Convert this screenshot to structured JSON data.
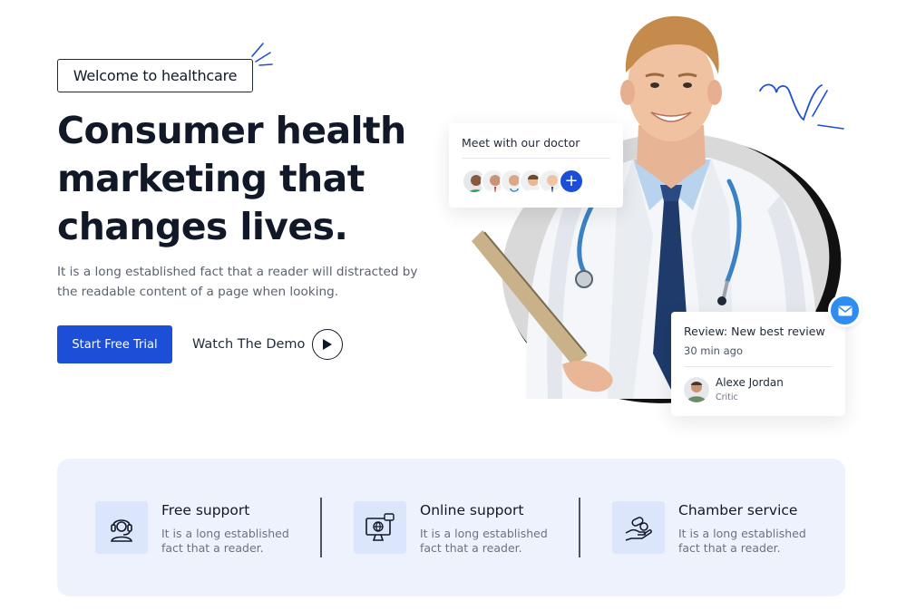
{
  "hero": {
    "badge": "Welcome to healthcare",
    "title_line1": "Consumer health",
    "title_line2": "marketing that",
    "title_line3": "changes lives.",
    "description": "It is a long established fact that a reader will distracted by the readable content of a page when looking.",
    "cta_primary": "Start Free Trial",
    "cta_secondary": "Watch The Demo"
  },
  "doctor_card": {
    "title": "Meet  with our doctor",
    "add_label": "+"
  },
  "review_card": {
    "title": "Review: New best review",
    "time": "30 min ago",
    "reviewer_name": "Alexe Jordan",
    "reviewer_role": "Critic"
  },
  "features": [
    {
      "title": "Free support",
      "text": "It is a long established fact that a reader.",
      "icon": "headset-icon"
    },
    {
      "title": "Online support",
      "text": "It is a long established fact that a reader.",
      "icon": "monitor-globe-icon"
    },
    {
      "title": "Chamber service",
      "text": "It is a long established fact that a reader.",
      "icon": "hand-pills-icon"
    }
  ],
  "colors": {
    "primary": "#1d4ed8",
    "features_bg": "#eef2fd",
    "icon_bg": "#dbe5fb",
    "mail": "#2f8cf0"
  }
}
